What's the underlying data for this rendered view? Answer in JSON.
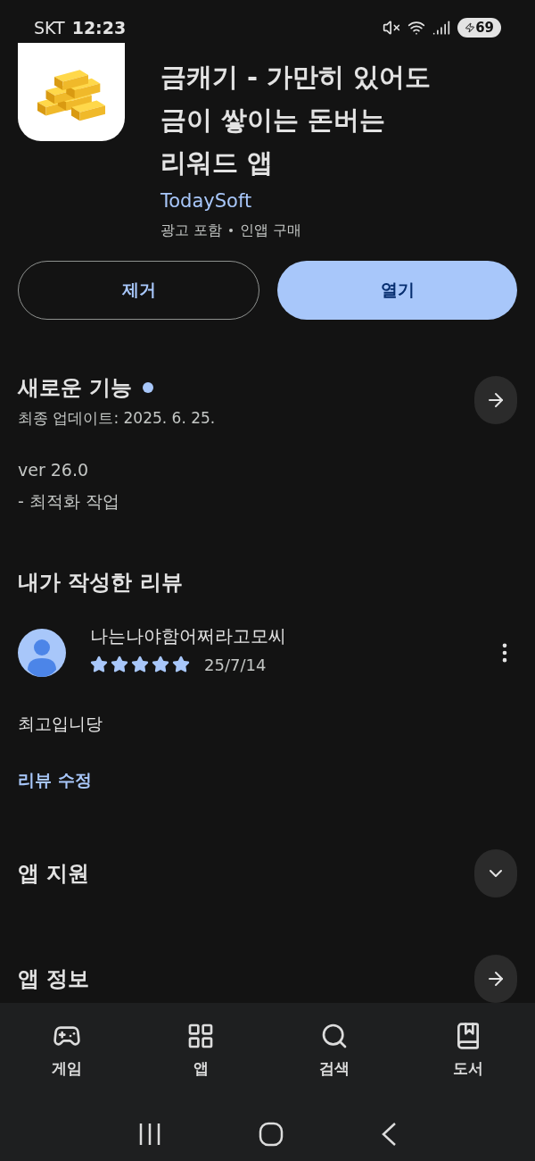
{
  "status_bar": {
    "carrier": "SKT",
    "time": "12:23",
    "battery": "69"
  },
  "app": {
    "title_lines": [
      "금캐기 - 가만히 있어도",
      "금이 쌓이는 돈버는",
      "리워드 앱"
    ],
    "developer": "TodaySoft",
    "meta": [
      "광고 포함",
      "인앱 구매"
    ]
  },
  "buttons": [
    {
      "label": "제거",
      "kind": "outline"
    },
    {
      "label": "열기",
      "kind": "filled"
    }
  ],
  "whats_new": {
    "title": "새로운 기능",
    "new_dot": true,
    "updated": "최종 업데이트: 2025. 6. 25.",
    "notes": [
      "ver 26.0",
      "- 최적화 작업"
    ]
  },
  "my_review": {
    "heading": "내가 작성한 리뷰",
    "author": "나는나야함어쩌라고모씨",
    "stars": 5,
    "date": "25/7/14",
    "text": "최고입니당",
    "edit_link": "리뷰 수정"
  },
  "sections": [
    {
      "title": "앱 지원",
      "kind": "expand"
    },
    {
      "title": "앱 정보",
      "kind": "arrow"
    }
  ],
  "bottom_nav": [
    {
      "label": "게임",
      "kind": "games",
      "selected": false
    },
    {
      "label": "앱",
      "kind": "apps",
      "selected": false
    },
    {
      "label": "검색",
      "kind": "search",
      "selected": false
    },
    {
      "label": "도서",
      "kind": "books",
      "selected": false
    }
  ]
}
